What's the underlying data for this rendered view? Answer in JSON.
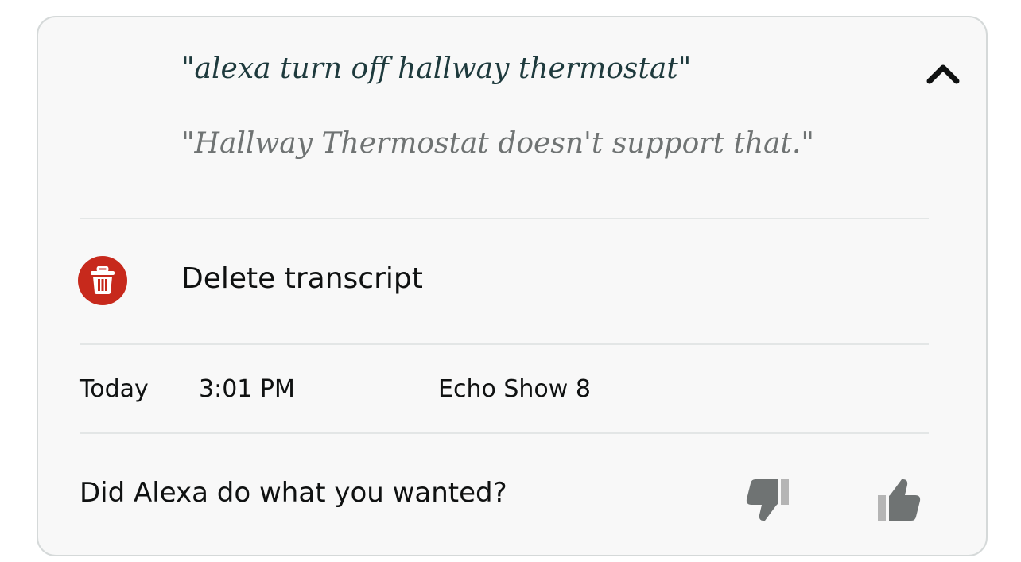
{
  "transcript": {
    "utterance": "\"alexa turn off hallway thermostat\"",
    "response": "\"Hallway Thermostat doesn't support that.\""
  },
  "actions": {
    "delete_label": "Delete transcript"
  },
  "details": {
    "day": "Today",
    "time": "3:01 PM",
    "device": "Echo Show 8"
  },
  "feedback": {
    "question": "Did Alexa do what you wanted?"
  },
  "icons": {
    "collapse": "chevron-up-icon",
    "delete": "trash-icon",
    "negative": "thumbs-down-icon",
    "positive": "thumbs-up-icon"
  },
  "colors": {
    "delete_red": "#c7291c",
    "utterance_text": "#1e3a3d",
    "response_text": "#6f7373",
    "thumb_gray": "#6f7373"
  }
}
